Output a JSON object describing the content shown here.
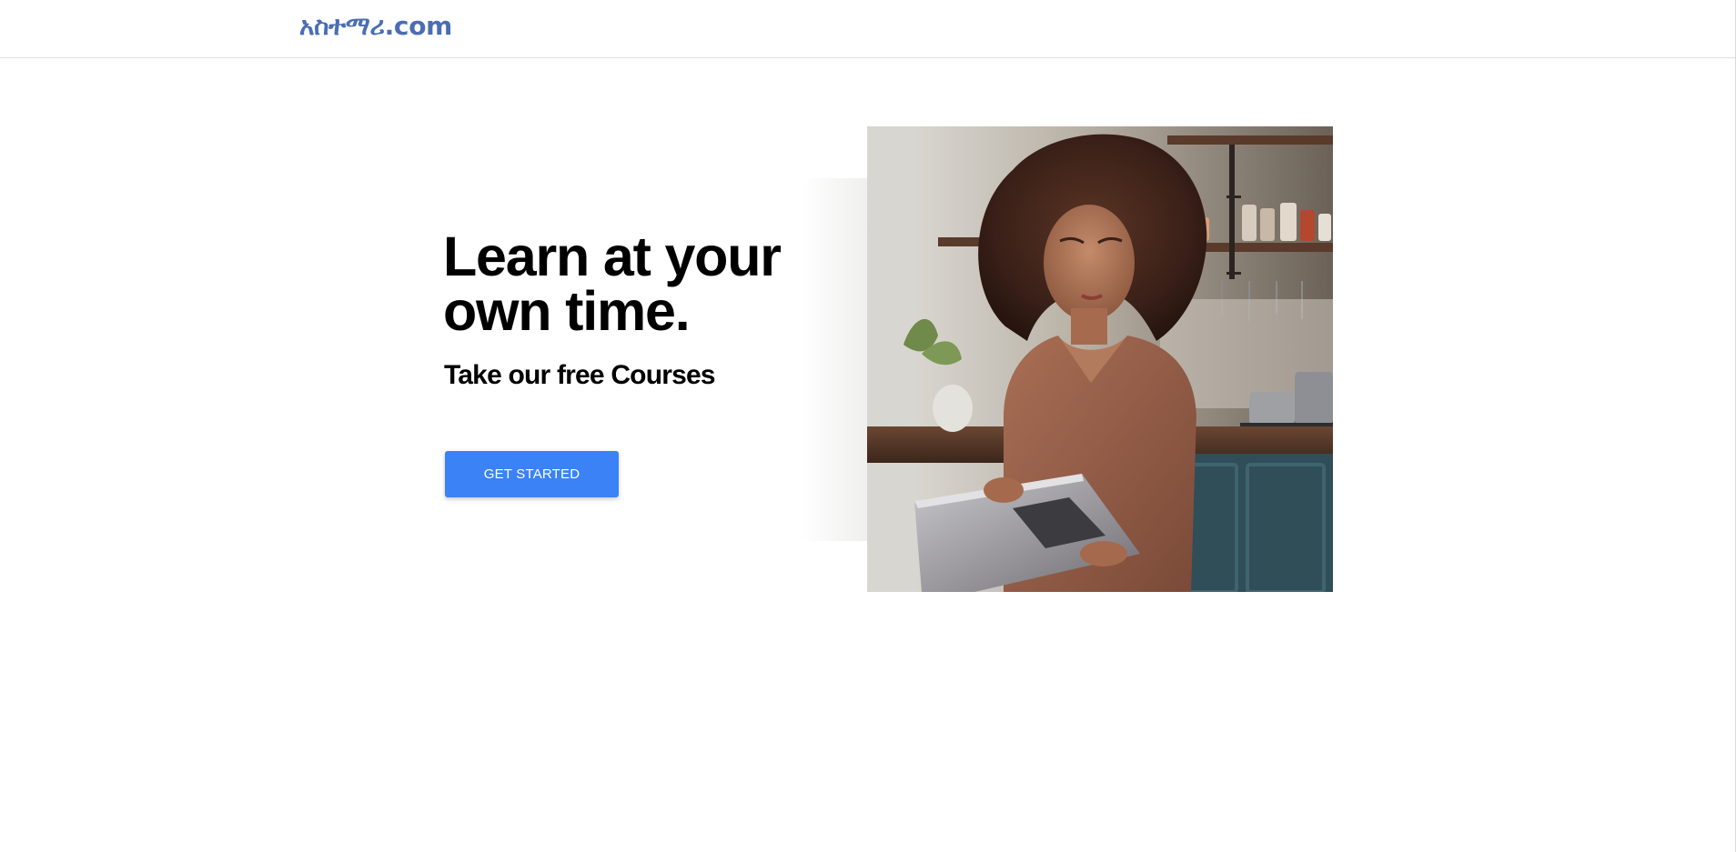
{
  "navbar": {
    "brand": "አስተማሪ.com"
  },
  "hero": {
    "heading_line1": "Learn at your",
    "heading_line2": "own time.",
    "subheading": "Take our free Courses",
    "cta_label": "GET STARTED",
    "photo_alt": "Woman with curly hair using a laptop in a kitchen"
  },
  "colors": {
    "brand": "#4b6db2",
    "cta_background": "#3b82f6",
    "cta_text": "#ffffff",
    "heading_text": "#000000"
  }
}
